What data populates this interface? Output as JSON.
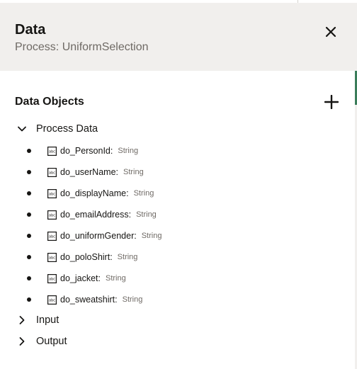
{
  "panel": {
    "title": "Data",
    "subtitle": "Process: UniformSelection",
    "close_icon": "close-icon"
  },
  "data_objects": {
    "heading": "Data Objects",
    "add_icon": "plus-icon",
    "groups": [
      {
        "label": "Process Data",
        "expanded": true,
        "items": [
          {
            "name": "do_PersonId:",
            "type": "String"
          },
          {
            "name": "do_userName:",
            "type": "String"
          },
          {
            "name": "do_displayName:",
            "type": "String"
          },
          {
            "name": "do_emailAddress:",
            "type": "String"
          },
          {
            "name": "do_uniformGender:",
            "type": "String"
          },
          {
            "name": "do_poloShirt:",
            "type": "String"
          },
          {
            "name": "do_jacket:",
            "type": "String"
          },
          {
            "name": "do_sweatshirt:",
            "type": "String"
          }
        ]
      },
      {
        "label": "Input",
        "expanded": false,
        "items": []
      },
      {
        "label": "Output",
        "expanded": false,
        "items": []
      }
    ]
  },
  "colors": {
    "header_bg": "#f1efed",
    "text": "#161513",
    "muted_text": "#6f6a65",
    "scroll_accent": "#3a7d5a"
  }
}
